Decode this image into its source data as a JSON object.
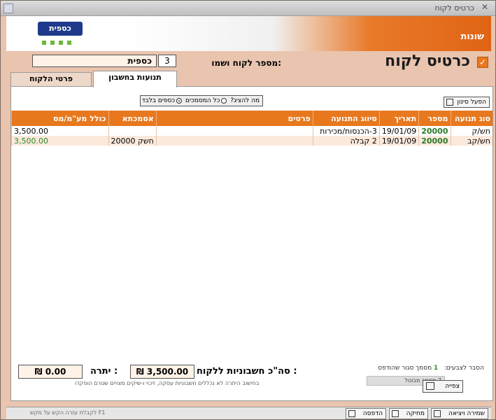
{
  "window": {
    "title": "כרטיס לקוח"
  },
  "logo": {
    "text": "כספית"
  },
  "banner": {
    "section": "שונות"
  },
  "header": {
    "title": "כרטיס לקוח",
    "customer_label": "מספר לקוח ושמו:",
    "customer_number": "3",
    "customer_name": "כספית"
  },
  "tabs": [
    {
      "label": "תנועות בחשבון",
      "active": true
    },
    {
      "label": "פרטי הלקוח",
      "active": false
    }
  ],
  "filter": {
    "button_label": "הפעל סינון",
    "show_label": "מה להציג?",
    "option_all": "כל המסמכים",
    "option_money": "כספים בלבד",
    "selected": "option_money"
  },
  "table": {
    "columns": [
      "סוג תנועה",
      "מספר",
      "תאריך",
      "סיווג התנועה",
      "פרטים",
      "אסמכתא",
      "כולל מע\"מ/מס"
    ],
    "rows": [
      {
        "type": "חש/ק",
        "number": "20000",
        "date": "19/01/09",
        "classification": "3-הכנסות/מכירות",
        "details": "",
        "reference": "",
        "amount": "3,500.00",
        "amount_green": false
      },
      {
        "type": "חש/קב",
        "number": "20000",
        "date": "19/01/09",
        "classification": "2 קבלה",
        "details": "",
        "reference": "חשק 20000",
        "amount": "3,500.00",
        "amount_green": true
      }
    ]
  },
  "totals": {
    "total_label": "סה\"כ חשבוניות ללקוח :",
    "total_value": "₪ 3,500.00",
    "balance_label": "יתרה :",
    "balance_value": "₪ 0.00",
    "note": "בחישוב היתרה לא נכללים חשבוניות עסקה, זיכוי ו-שיקים מצויים שטרם הופקדו"
  },
  "legend": {
    "title": "הסבר לצבעים:",
    "green_num": "1",
    "green_text": "מסמך סגור שהודפס",
    "gray_text": "7 מסמך מבוטל"
  },
  "buttons": {
    "view": "צפייה",
    "save_exit": "שמירה ויציאה",
    "delete": "מחיקה",
    "print": "הדפסה"
  },
  "bottom_hint": "לקבלת עזרה הקש על מקש F1"
}
